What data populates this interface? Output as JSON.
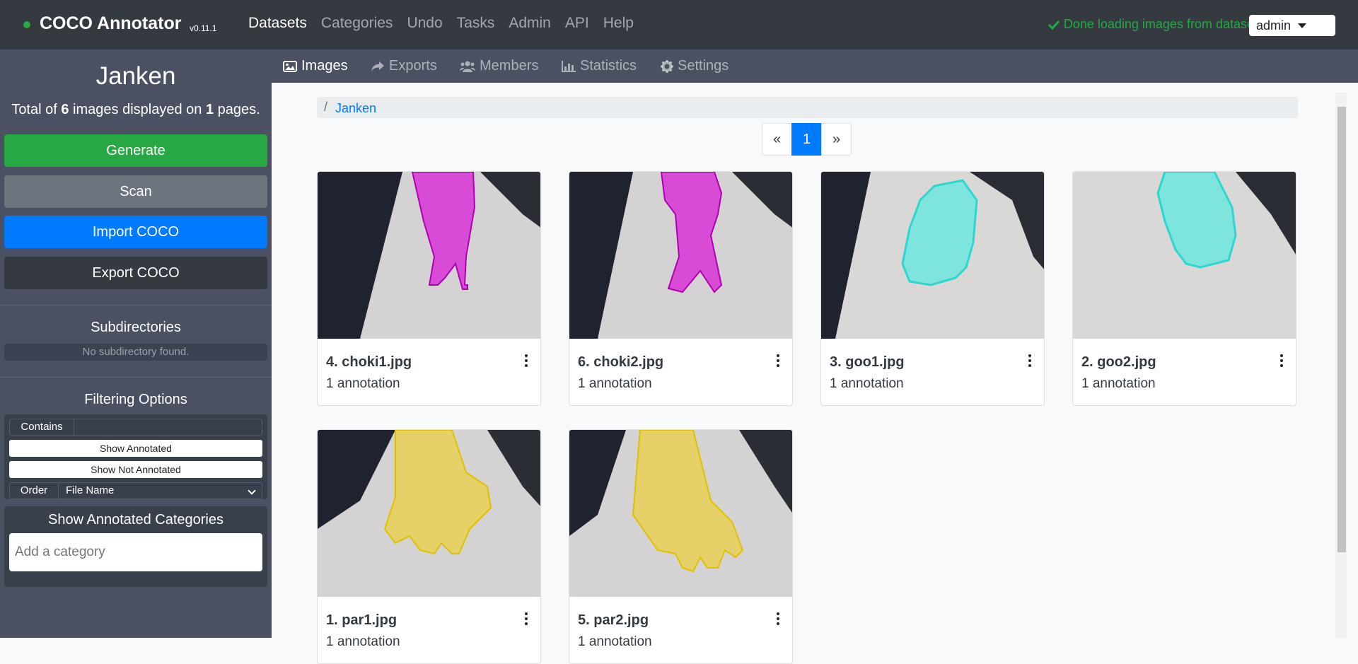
{
  "navbar": {
    "brand": "COCO Annotator",
    "version": "v0.11.1",
    "links": [
      "Datasets",
      "Categories",
      "Undo",
      "Tasks",
      "Admin",
      "API",
      "Help"
    ],
    "active_link": "Datasets",
    "status": "Done loading images from dataset",
    "user": "admin",
    "status_color": "#28a745"
  },
  "sidebar": {
    "dataset_name": "Janken",
    "info_prefix": "Total of ",
    "image_count": "6",
    "info_middle": " images displayed on ",
    "page_count": "1",
    "info_suffix": " pages.",
    "buttons": {
      "generate": "Generate",
      "scan": "Scan",
      "import": "Import COCO",
      "export": "Export COCO"
    },
    "subdirectories_title": "Subdirectories",
    "no_subdirectory": "No subdirectory found.",
    "filtering_title": "Filtering Options",
    "contains_label": "Contains",
    "contains_value": "",
    "show_annotated": "Show Annotated",
    "show_not_annotated": "Show Not Annotated",
    "order_label": "Order",
    "order_value": "File Name",
    "categories_title": "Show Annotated Categories",
    "category_placeholder": "Add a category"
  },
  "subnav": {
    "tabs": [
      "Images",
      "Exports",
      "Members",
      "Statistics",
      "Settings"
    ],
    "active": "Images"
  },
  "main": {
    "breadcrumb_sep": "/",
    "breadcrumb": "Janken",
    "pager": {
      "prev": "«",
      "current": "1",
      "next": "»"
    },
    "images": [
      {
        "title": "4. choki1.jpg",
        "annotations": "1 annotation",
        "mask_color": "#d81ed8",
        "shape": "choki"
      },
      {
        "title": "6. choki2.jpg",
        "annotations": "1 annotation",
        "mask_color": "#d81ed8",
        "shape": "choki2"
      },
      {
        "title": "3. goo1.jpg",
        "annotations": "1 annotation",
        "mask_color": "#5ee8e0",
        "shape": "goo"
      },
      {
        "title": "2. goo2.jpg",
        "annotations": "1 annotation",
        "mask_color": "#5ee8e0",
        "shape": "goo2"
      },
      {
        "title": "1. par1.jpg",
        "annotations": "1 annotation",
        "mask_color": "#f0d020",
        "shape": "par"
      },
      {
        "title": "5. par2.jpg",
        "annotations": "1 annotation",
        "mask_color": "#f0d020",
        "shape": "par2"
      }
    ]
  }
}
